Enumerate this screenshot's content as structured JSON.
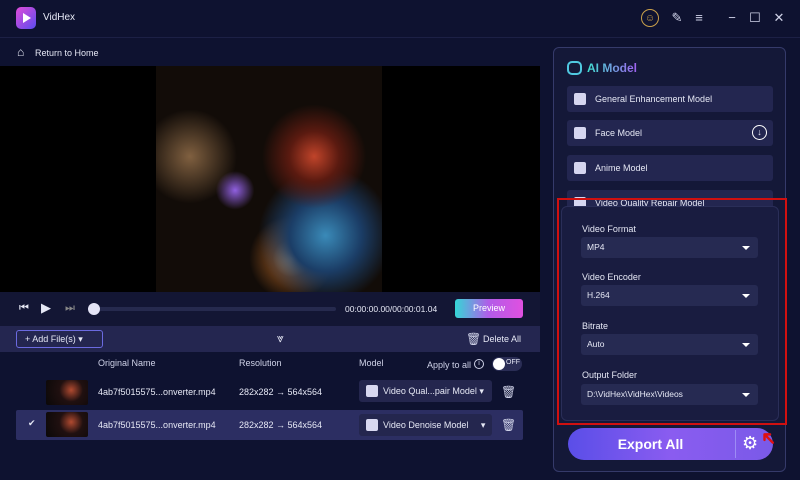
{
  "app": {
    "title": "VidHex"
  },
  "nav": {
    "return_home": "Return to Home"
  },
  "player": {
    "time": "00:00:00.00/00:00:01.04",
    "preview_label": "Preview"
  },
  "toolbar": {
    "add_files": "Add File(s)",
    "delete_all": "Delete All"
  },
  "table": {
    "headers": {
      "name": "Original Name",
      "resolution": "Resolution",
      "model": "Model",
      "apply_all": "Apply to all",
      "toggle": "OFF"
    },
    "rows": [
      {
        "name": "4ab7f5015575...onverter.mp4",
        "resolution": "282x282 → 564x564",
        "model": "Video Qual...pair Model",
        "selected": false
      },
      {
        "name": "4ab7f5015575...onverter.mp4",
        "resolution": "282x282 → 564x564",
        "model": "Video Denoise Model",
        "selected": true
      }
    ]
  },
  "ai": {
    "title": "AI Model",
    "models": [
      "General Enhancement Model",
      "Face Model",
      "Anime Model",
      "Video Quality Repair Model"
    ]
  },
  "settings": {
    "format_label": "Video Format",
    "format": "MP4",
    "encoder_label": "Video Encoder",
    "encoder": "H.264",
    "bitrate_label": "Bitrate",
    "bitrate": "Auto",
    "folder_label": "Output Folder",
    "folder": "D:\\VidHex\\VidHex\\Videos"
  },
  "export": {
    "label": "Export All"
  },
  "colors": {
    "bg": "#0e1230",
    "accent": "#6b5ae8",
    "highlight": "#d01010"
  }
}
